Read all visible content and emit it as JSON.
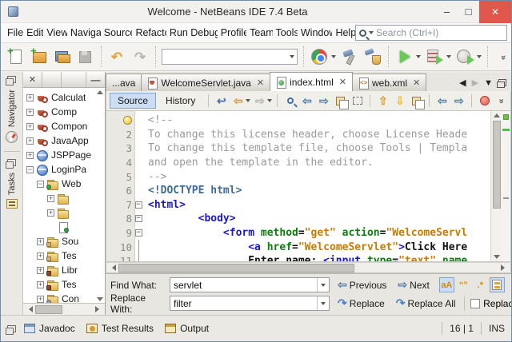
{
  "window": {
    "title": "Welcome - NetBeans IDE 7.4 Beta",
    "controls": {
      "minimize": "–",
      "maximize": "□",
      "close": "✕"
    }
  },
  "menu": {
    "items": [
      "File",
      "Edit",
      "View",
      "Navigat",
      "Source",
      "Refacto",
      "Run",
      "Debug",
      "Profile",
      "Team",
      "Tools",
      "Window",
      "Help"
    ],
    "search_placeholder": "Search (Ctrl+I)"
  },
  "toolbar": {
    "groups": [
      [
        {
          "n": "new-file-icon",
          "cls": "i-page-new"
        },
        {
          "n": "new-project-icon",
          "cls": "i-proj-new"
        },
        {
          "n": "open-project-icon",
          "cls": "i-proj-open"
        },
        {
          "n": "save-all-icon",
          "cls": "i-save-all"
        }
      ],
      [
        {
          "n": "undo-icon",
          "glyph": "↶",
          "gcls": "c-undo"
        },
        {
          "n": "redo-icon",
          "glyph": "↷",
          "gcls": "c-redo"
        }
      ],
      [
        {
          "n": "configuration-combobox",
          "cls": "i-combo",
          "combo": true
        }
      ],
      [
        {
          "n": "browser-chrome-icon",
          "cls": "i-chrome",
          "dd": true
        },
        {
          "n": "build-project-icon",
          "cls": "i-build"
        },
        {
          "n": "clean-build-icon",
          "cls": "i-clean"
        }
      ],
      [
        {
          "n": "run-project-icon",
          "cls": "i-run",
          "dd": true
        },
        {
          "n": "debug-project-icon",
          "cls": "i-debug",
          "dd": true
        },
        {
          "n": "profile-project-icon",
          "cls": "i-profile",
          "dd": true
        }
      ],
      [
        {
          "n": "toolbar-overflow-icon",
          "glyph": "»",
          "gcls": "chev2"
        }
      ]
    ]
  },
  "sidebar": {
    "tabs": [
      {
        "label": "Navigator",
        "icon": "compass-icon"
      },
      {
        "label": "Tasks",
        "icon": "tasks-icon"
      }
    ]
  },
  "tree": {
    "header": {
      "close": "✕",
      "minimize": "—"
    },
    "items": [
      {
        "label": "Calculat",
        "icon": "coffee",
        "toggle": "+",
        "level": 0
      },
      {
        "label": "Comp",
        "icon": "coffee",
        "toggle": "+",
        "level": 0
      },
      {
        "label": "Compon",
        "icon": "coffee",
        "toggle": "+",
        "level": 0
      },
      {
        "label": "JavaApp",
        "icon": "coffee",
        "toggle": "+",
        "level": 0
      },
      {
        "label": "JSPPage",
        "icon": "globe",
        "toggle": "+",
        "level": 0
      },
      {
        "label": "LoginPa",
        "icon": "globe",
        "toggle": "−",
        "level": 0
      },
      {
        "label": "Web",
        "icon": "folder-web",
        "toggle": "−",
        "level": 1
      },
      {
        "label": "",
        "icon": "folder",
        "toggle": "+",
        "level": 2
      },
      {
        "label": "",
        "icon": "folder",
        "toggle": "+",
        "level": 2
      },
      {
        "label": "",
        "icon": "file-html",
        "toggle": "",
        "level": 2
      },
      {
        "label": "Sou",
        "icon": "folder-pkg",
        "toggle": "+",
        "level": 1
      },
      {
        "label": "Tes",
        "icon": "folder-pkg",
        "toggle": "+",
        "level": 1
      },
      {
        "label": "Libr",
        "icon": "folder-lib",
        "toggle": "+",
        "level": 1
      },
      {
        "label": "Tes",
        "icon": "folder-lib",
        "toggle": "+",
        "level": 1
      },
      {
        "label": "Con",
        "icon": "folder-cfg",
        "toggle": "+",
        "level": 1
      }
    ]
  },
  "editor": {
    "tabs": [
      {
        "label": "...ava",
        "icon": "",
        "close": false,
        "active": false
      },
      {
        "label": "WelcomeServlet.java",
        "icon": "java",
        "close": true,
        "active": false
      },
      {
        "label": "index.html",
        "icon": "html",
        "close": true,
        "active": true
      },
      {
        "label": "web.xml",
        "icon": "xml",
        "close": true,
        "active": false
      }
    ],
    "views": {
      "source": "Source",
      "history": "History"
    },
    "toolbar_icons": [
      {
        "sep": true
      },
      {
        "n": "last-edit-location-icon",
        "glyph": "↩",
        "gcls": "eg-dkblue"
      },
      {
        "n": "back-icon",
        "glyph": "⇦",
        "gcls": "eg-orange",
        "dd": true
      },
      {
        "n": "forward-icon",
        "glyph": "⇨",
        "gcls": "eg-gray",
        "dd": true
      },
      {
        "sep": true
      },
      {
        "n": "find-selection-icon",
        "cls": "mag2"
      },
      {
        "n": "previous-occurrence-icon",
        "glyph": "⇦",
        "gcls": "eg-blue"
      },
      {
        "n": "next-occurrence-icon",
        "glyph": "⇨",
        "gcls": "eg-blue"
      },
      {
        "n": "toggle-highlight-icon",
        "cls": "dbl-sq"
      },
      {
        "n": "rectangular-selection-icon",
        "cls": "dash-sq"
      },
      {
        "sep": true
      },
      {
        "n": "previous-bookmark-icon",
        "glyph": "⇧",
        "gcls": "eg-orange"
      },
      {
        "n": "next-bookmark-icon",
        "glyph": "⇩",
        "gcls": "eg-yellow"
      },
      {
        "n": "toggle-bookmark-icon",
        "cls": "dbl-sq"
      },
      {
        "sep": true
      },
      {
        "n": "shift-left-icon",
        "glyph": "⇦",
        "gcls": "eg-blue"
      },
      {
        "n": "shift-right-icon",
        "glyph": "⇨",
        "gcls": "eg-blue"
      },
      {
        "sep": true
      },
      {
        "n": "record-macro-icon",
        "cls": "rec"
      },
      {
        "n": "editor-overflow-icon",
        "glyph": "»",
        "gcls": "chev2"
      }
    ],
    "lines": [
      {
        "num": "",
        "bulb": true,
        "seg": [
          [
            "cm",
            "<!--"
          ]
        ]
      },
      {
        "num": "2",
        "seg": [
          [
            "cm",
            "To change this license header, choose License Heade"
          ]
        ]
      },
      {
        "num": "3",
        "seg": [
          [
            "cm",
            "To change this template file, choose Tools | Templa"
          ]
        ]
      },
      {
        "num": "4",
        "seg": [
          [
            "cm",
            "and open the template in the editor."
          ]
        ]
      },
      {
        "num": "5",
        "seg": [
          [
            "cm",
            "-->"
          ]
        ]
      },
      {
        "num": "6",
        "seg": [
          [
            "dt",
            "<!DOCTYPE html>"
          ]
        ]
      },
      {
        "num": "7",
        "fold": true,
        "seg": [
          [
            "tg",
            "<html>"
          ]
        ]
      },
      {
        "num": "8",
        "fold": true,
        "seg": [
          [
            "pl",
            "        "
          ],
          [
            "tg",
            "<body>"
          ]
        ]
      },
      {
        "num": "9",
        "fold": true,
        "seg": [
          [
            "pl",
            "            "
          ],
          [
            "tg",
            "<form"
          ],
          [
            "pl",
            " "
          ],
          [
            "at",
            "method"
          ],
          [
            "pl",
            "="
          ],
          [
            "st",
            "\"get\""
          ],
          [
            "pl",
            " "
          ],
          [
            "at",
            "action"
          ],
          [
            "pl",
            "="
          ],
          [
            "st",
            "\"WelcomeServl"
          ]
        ]
      },
      {
        "num": "10",
        "fline": true,
        "seg": [
          [
            "pl",
            "                "
          ],
          [
            "tg",
            "<a"
          ],
          [
            "pl",
            " "
          ],
          [
            "at",
            "href"
          ],
          [
            "pl",
            "="
          ],
          [
            "st",
            "\"WelcomeServlet\""
          ],
          [
            "tg",
            ">"
          ],
          [
            "pl",
            "Click Here"
          ]
        ]
      },
      {
        "num": "11",
        "fline": true,
        "seg": [
          [
            "pl",
            "                "
          ],
          [
            "pl",
            "Enter name: "
          ],
          [
            "tg",
            "<input"
          ],
          [
            "pl",
            " "
          ],
          [
            "at",
            "type"
          ],
          [
            "pl",
            "="
          ],
          [
            "st",
            "\"text\""
          ],
          [
            "pl",
            " "
          ],
          [
            "at",
            "name"
          ]
        ]
      }
    ]
  },
  "find": {
    "find_label": "Find What:",
    "find_value": "servlet",
    "replace_label": "Replace With:",
    "replace_value": "filter",
    "previous_label": "Previous",
    "next_label": "Next",
    "replace_label_btn": "Replace",
    "replace_all_label": "Replace All",
    "checkbox_label": "Replace Ba",
    "toggles": [
      {
        "n": "match-case-toggle",
        "text": "aA",
        "active": true
      },
      {
        "n": "whole-words-toggle",
        "text": "“”",
        "active": false
      },
      {
        "n": "regex-toggle",
        "text": ".*",
        "active": false
      },
      {
        "n": "highlight-results-toggle",
        "doc": true,
        "active": true
      }
    ]
  },
  "statusbar": {
    "tabs": [
      {
        "label": "Javadoc",
        "icon": "javadoc-window-icon",
        "cls": ""
      },
      {
        "label": "Test Results",
        "icon": "test-results-icon",
        "cls": "clock"
      },
      {
        "label": "Output",
        "icon": "output-window-icon",
        "cls": "out"
      }
    ],
    "position": "16 | 1",
    "mode": "INS"
  },
  "colors": {
    "selection_blue": "#cbdcf3",
    "tag_blue": "#1b18c9",
    "attr_green": "#0e7c10",
    "string_orange": "#c97a00",
    "comment_gray": "#9a9a9a",
    "doctype_blue": "#3f6b99",
    "close_red": "#e0574b",
    "run_green": "#6cc75a"
  }
}
